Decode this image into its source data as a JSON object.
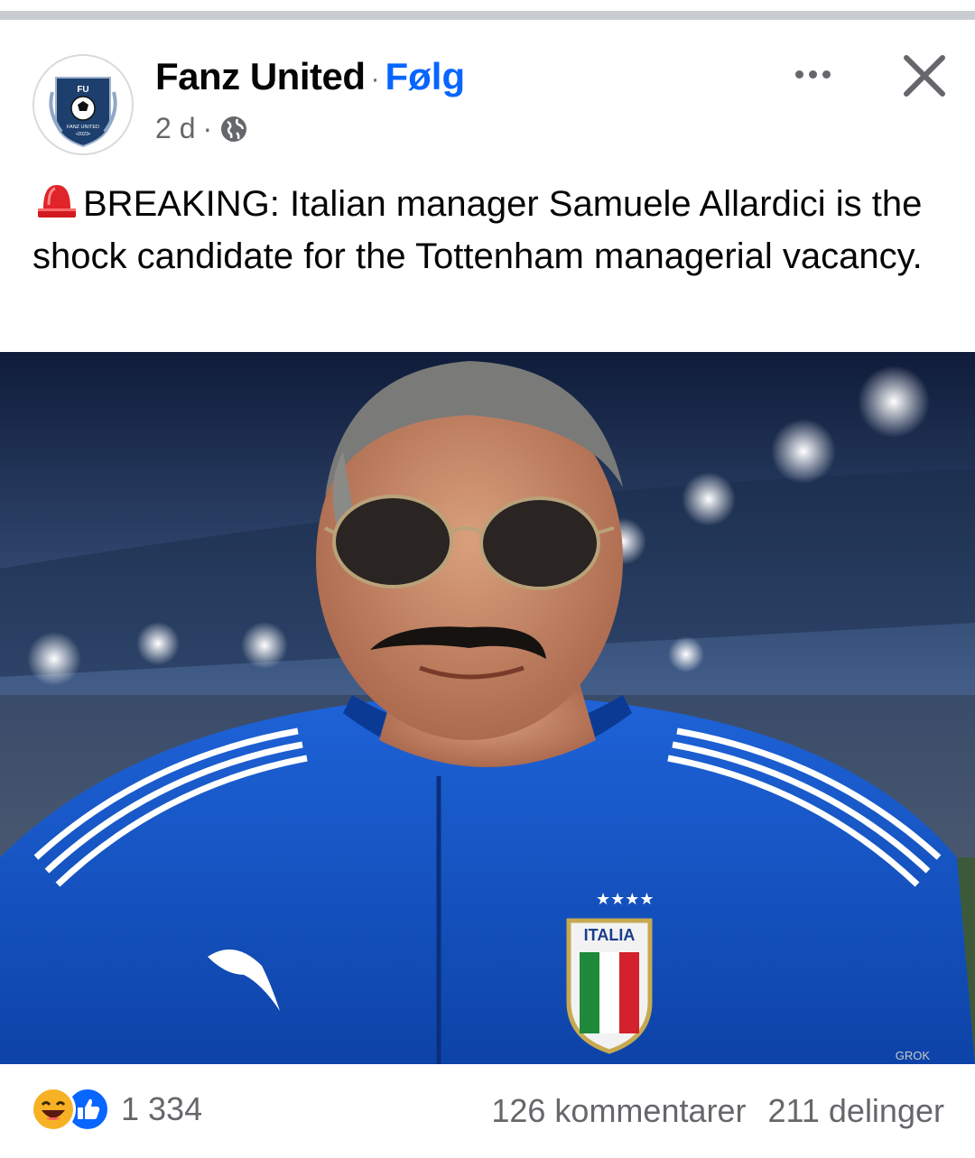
{
  "post": {
    "page_name": "Fanz United",
    "separator": "·",
    "follow_label": "Følg",
    "time": "2 d",
    "time_separator": "·",
    "avatar": {
      "top_text": "FU",
      "bottom_text": "FANZ UNITED",
      "year": "•2023•"
    },
    "text": "BREAKING: Italian manager Samuele Allardici is the shock candidate for the Tottenham managerial vacancy.",
    "image": {
      "crest_text": "ITALIA",
      "watermark": "GROK"
    }
  },
  "footer": {
    "reaction_count": "1 334",
    "comments": "126 kommentarer",
    "shares": "211 delinger"
  },
  "icons": {
    "more": "more-options-icon",
    "close": "close-icon",
    "audience": "globe-icon",
    "alert": "siren-icon",
    "reactions": [
      "haha-icon",
      "like-icon"
    ]
  },
  "colors": {
    "brand_blue": "#0866ff",
    "secondary_text": "#65676b",
    "divider": "#c9ccd1"
  }
}
